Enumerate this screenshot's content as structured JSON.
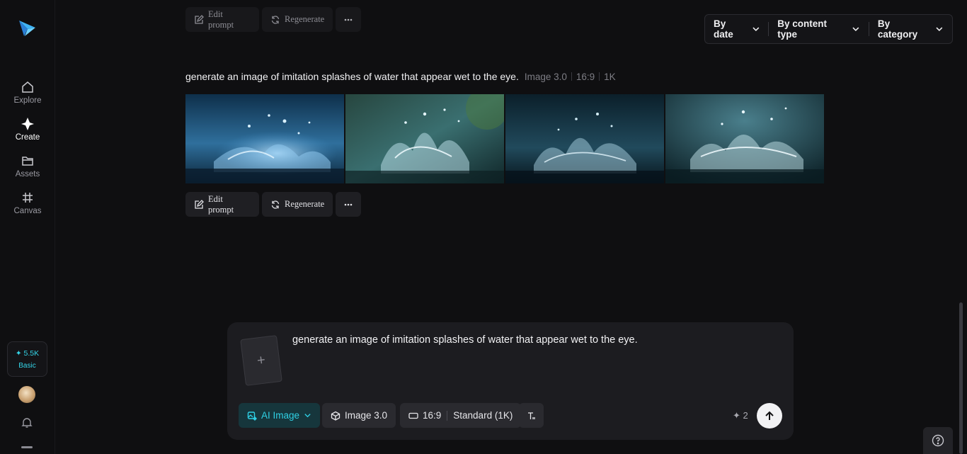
{
  "sidebar": {
    "items": [
      {
        "label": "Explore",
        "icon": "home-icon",
        "active": false
      },
      {
        "label": "Create",
        "icon": "sparkle-icon",
        "active": true
      },
      {
        "label": "Assets",
        "icon": "folder-icon",
        "active": false
      },
      {
        "label": "Canvas",
        "icon": "grid-icon",
        "active": false
      }
    ],
    "credits": {
      "count": "✦ 5.5K",
      "plan": "Basic"
    }
  },
  "filters": [
    "By date",
    "By content type",
    "By category"
  ],
  "actions": {
    "edit_prompt": "Edit prompt",
    "regenerate": "Regenerate"
  },
  "generation": {
    "prompt": "generate an image of imitation splashes of water that appear wet to the eye.",
    "model": "Image 3.0",
    "ratio": "16:9",
    "resolution": "1K",
    "images": [
      "water-splash-1",
      "water-splash-2",
      "water-splash-3",
      "water-splash-4"
    ]
  },
  "composer": {
    "input": "generate an image of imitation splashes of water that appear wet to the eye.",
    "mode": "AI Image",
    "model": "Image 3.0",
    "ratio": "16:9",
    "quality": "Standard (1K)",
    "cost": "✦ 2"
  },
  "colors": {
    "accent": "#2fd0e4",
    "background": "#0f0f11",
    "panel": "#1c1c20"
  }
}
